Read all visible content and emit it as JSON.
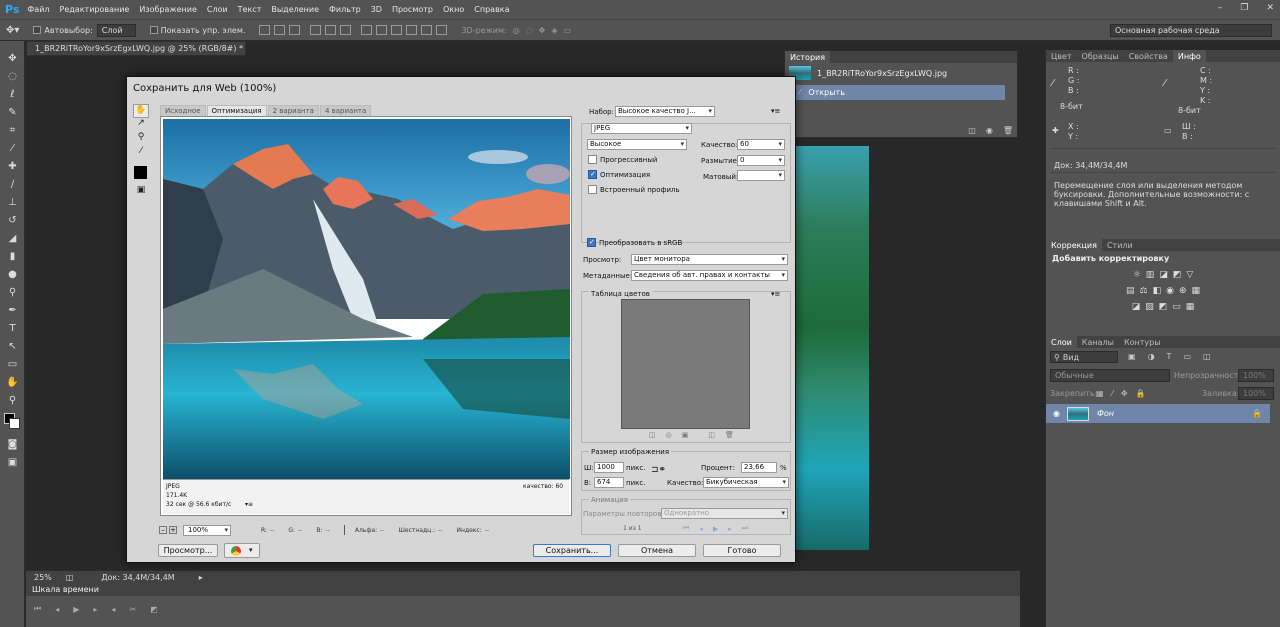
{
  "app": {
    "logo": "Ps"
  },
  "menu": [
    "Файл",
    "Редактирование",
    "Изображение",
    "Слои",
    "Текст",
    "Выделение",
    "Фильтр",
    "3D",
    "Просмотр",
    "Окно",
    "Справка"
  ],
  "options": {
    "autoselect_label": "Автовыбор:",
    "autoselect_value": "Слой",
    "show_controls_label": "Показать упр. элем.",
    "mode3d_label": "3D-режим:",
    "workspace": "Основная рабочая среда"
  },
  "document": {
    "tab_title": "1_BR2RiTRoYor9xSrzEgxLWQ.jpg @ 25% (RGB/8#) *",
    "zoom": "25%",
    "doc_size": "Док: 34,4M/34,4M"
  },
  "timeline": {
    "title": "Шкала времени"
  },
  "history": {
    "tab": "История",
    "snapshot_name": "1_BR2RiTRoYor9xSrzEgxLWQ.jpg",
    "step": "Открыть"
  },
  "info_panel": {
    "tabs": [
      "Цвет",
      "Образцы",
      "Свойства",
      "Инфо"
    ],
    "rgb": [
      "R :",
      "G :",
      "B :"
    ],
    "cmyk": [
      "C :",
      "M :",
      "Y :",
      "K :"
    ],
    "bits1": "8-бит",
    "bits2": "8-бит",
    "x": "X :",
    "y": "Y :",
    "w": "Ш :",
    "h": "В :",
    "doc": "Док: 34,4M/34,4M",
    "hint": "Перемещение слоя или выделения методом буксировки. Дополнительные возможности: с клавишами Shift и Alt."
  },
  "adjust_panel": {
    "tabs": [
      "Коррекция",
      "Стили"
    ],
    "title": "Добавить корректировку"
  },
  "layers_panel": {
    "tabs": [
      "Слои",
      "Каналы",
      "Контуры"
    ],
    "filter": "Вид",
    "blend": "Обычные",
    "opacity_label": "Непрозрачность:",
    "opacity": "100%",
    "lock_label": "Закрепить:",
    "fill_label": "Заливка:",
    "fill": "100%",
    "layer_name": "Фон"
  },
  "dialog": {
    "title": "Сохранить для Web (100%)",
    "tabs": [
      "Исходное",
      "Оптимизация",
      "2 варианта",
      "4 варианта"
    ],
    "preview_info": [
      "JPEG",
      "171.4K",
      "32 сек @ 56.6 кбит/с"
    ],
    "preview_quality": "качество: 60",
    "zoom": "100%",
    "bottom_labels": [
      "R:",
      "G:",
      "B:",
      "Альфа:",
      "Шестнадц.:",
      "Индекс:"
    ],
    "bottom_values": [
      "--",
      "--",
      "--",
      "--",
      "--",
      "--"
    ],
    "preset_label": "Набор:",
    "preset": "Высокое качество J...",
    "format": "JPEG",
    "quality_preset": "Высокое",
    "quality_label": "Качество:",
    "quality": "60",
    "blur_label": "Размытие:",
    "blur": "0",
    "matte_label": "Матовый:",
    "progressive": "Прогрессивный",
    "optimized": "Оптимизация",
    "embed_profile": "Встроенный профиль",
    "convert_srgb": "Преобразовать в sRGB",
    "preview_label": "Просмотр:",
    "preview_value": "Цвет монитора",
    "metadata_label": "Метаданные:",
    "metadata_value": "Сведения об авт. правах и контакты",
    "color_table": "Таблица цветов",
    "image_size": "Размер изображения",
    "w_label": "Ш:",
    "w": "1000",
    "h_label": "В:",
    "h": "674",
    "px": "пикс.",
    "percent_label": "Процент:",
    "percent": "23,66",
    "percent_unit": "%",
    "quality2_label": "Качество:",
    "resample": "Бикубическая",
    "animation": "Анимация",
    "loop_label": "Параметры повторов:",
    "loop": "Однократно",
    "frame_counter": "1 из 1",
    "btn_preview": "Просмотр...",
    "btn_save": "Сохранить...",
    "btn_cancel": "Отмена",
    "btn_done": "Готово"
  },
  "colors": {
    "accent": "#31a8ff",
    "selected_row": "#6f86a8",
    "panel": "#535353",
    "workspace": "#282828"
  }
}
